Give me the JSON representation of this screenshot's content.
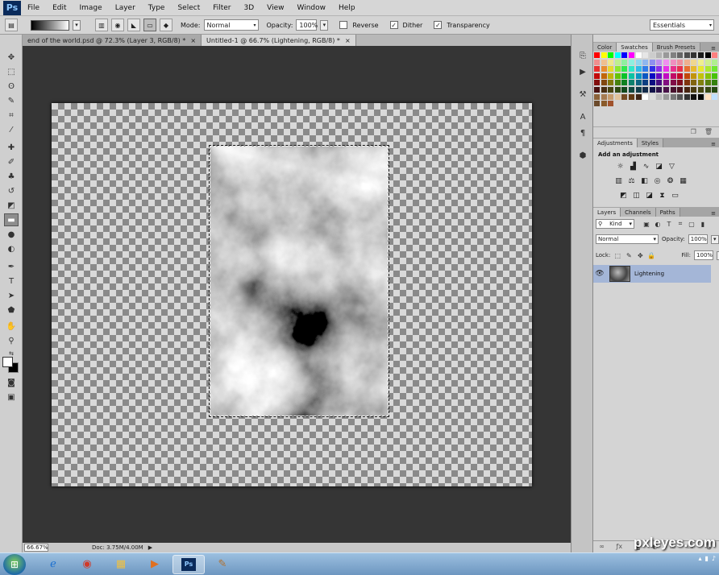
{
  "app": {
    "logo": "Ps"
  },
  "menu": [
    "File",
    "Edit",
    "Image",
    "Layer",
    "Type",
    "Select",
    "Filter",
    "3D",
    "View",
    "Window",
    "Help"
  ],
  "options": {
    "mode_label": "Mode:",
    "mode_value": "Normal",
    "opacity_label": "Opacity:",
    "opacity_value": "100%",
    "reverse_label": "Reverse",
    "dither_label": "Dither",
    "transparency_label": "Transparency",
    "workspace": "Essentials"
  },
  "tabs": [
    {
      "label": "end of the world.psd @ 72.3% (Layer 3, RGB/8) *",
      "close": "×"
    },
    {
      "label": "Untitled-1 @ 66.7% (Lightening, RGB/8) *",
      "close": "×"
    }
  ],
  "status": {
    "zoom": "66.67%",
    "doc": "Doc: 3.75M/4.00M"
  },
  "swatches_panel": {
    "tabs": [
      "Color",
      "Swatches",
      "Brush Presets"
    ]
  },
  "adjustments_panel": {
    "tabs": [
      "Adjustments",
      "Styles"
    ],
    "title": "Add an adjustment"
  },
  "layers_panel": {
    "tabs": [
      "Layers",
      "Channels",
      "Paths"
    ],
    "kind_label": "Kind",
    "blend_mode": "Normal",
    "opacity_label": "Opacity:",
    "opacity_value": "100%",
    "lock_label": "Lock:",
    "fill_label": "Fill:",
    "fill_value": "100%",
    "layer_name": "Lightening"
  },
  "watermark": "pxleyes.com",
  "colors": {
    "selected_layer": "#a4b6d7",
    "workspace_bg": "#353535"
  }
}
